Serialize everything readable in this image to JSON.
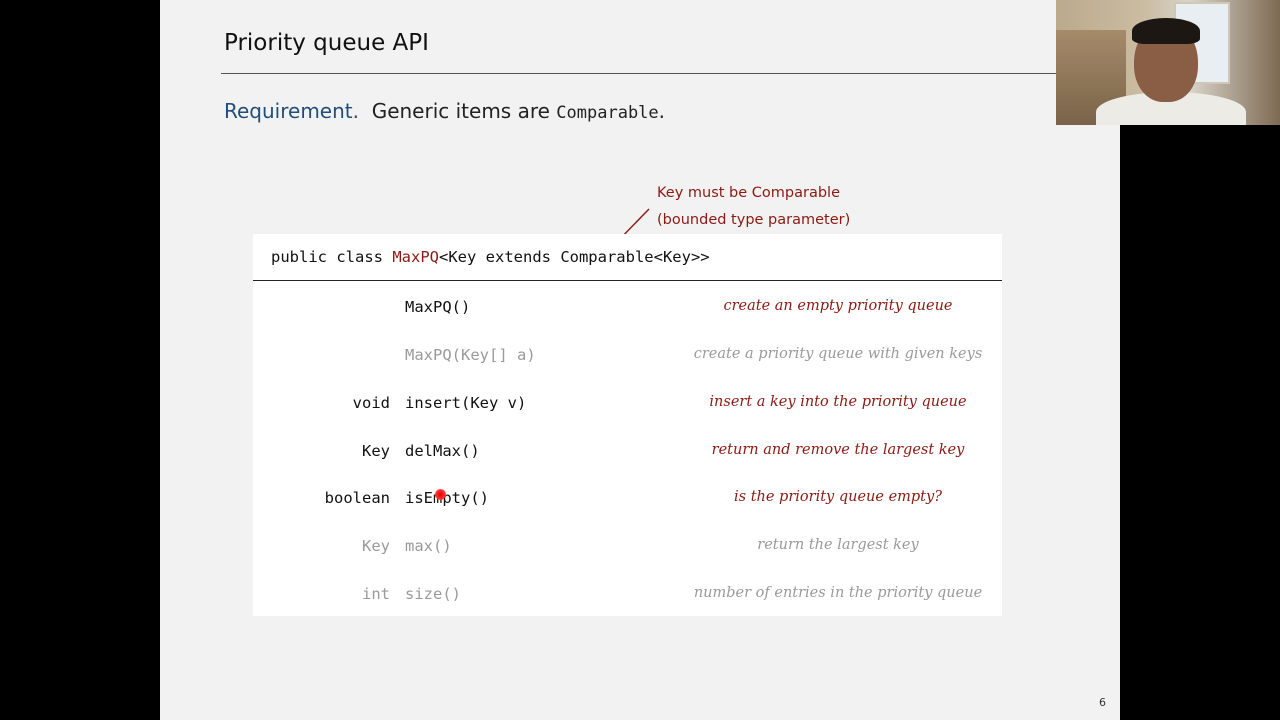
{
  "slide": {
    "title": "Priority queue API",
    "requirement": {
      "label": "Requirement.",
      "text_before": "Generic items are",
      "code": "Comparable",
      "text_after": "."
    },
    "annotation": {
      "line1": "Key must be Comparable",
      "line2": "(bounded type parameter)"
    },
    "api": {
      "sig_prefix": "public class ",
      "sig_class": "MaxPQ",
      "sig_suffix": "<Key extends Comparable<Key>>",
      "rows": [
        {
          "type": "",
          "method": "MaxPQ()",
          "desc": "create an empty priority queue",
          "dim": false
        },
        {
          "type": "",
          "method": "MaxPQ(Key[] a)",
          "desc": "create a priority queue with given keys",
          "dim": true
        },
        {
          "type": "void",
          "method": "insert(Key v)",
          "desc": "insert a key into the priority queue",
          "dim": false
        },
        {
          "type": "Key",
          "method": "delMax()",
          "desc": "return and remove the largest key",
          "dim": false
        },
        {
          "type": "boolean",
          "method": "isEmpty()",
          "desc": "is the priority queue empty?",
          "dim": false
        },
        {
          "type": "Key",
          "method": "max()",
          "desc": "return the largest key",
          "dim": true
        },
        {
          "type": "int",
          "method": "size()",
          "desc": "number of entries in the priority queue",
          "dim": true
        }
      ]
    },
    "page_number": "6"
  },
  "colors": {
    "accent_red": "#8b1a12",
    "heading_blue": "#1f4e79",
    "dim_gray": "#9a9a9a"
  }
}
